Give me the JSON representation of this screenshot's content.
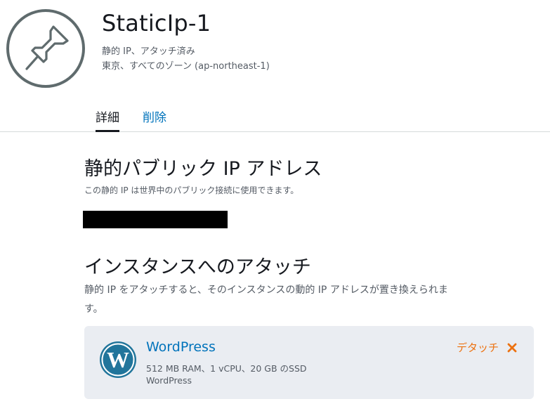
{
  "header": {
    "title": "StaticIp-1",
    "subtitle_status": "静的 IP、アタッチ済み",
    "subtitle_location": "東京、すべてのゾーン (ap-northeast-1)",
    "icon": "pin-icon"
  },
  "tabs": [
    {
      "label": "詳細",
      "active": true
    },
    {
      "label": "削除",
      "active": false
    }
  ],
  "public_ip_section": {
    "title": "静的パブリック IP アドレス",
    "description": "この静的 IP は世界中のパブリック接続に使用できます。"
  },
  "attach_section": {
    "title": "インスタンスへのアタッチ",
    "description_line1": "静的 IP をアタッチすると、そのインスタンスの動的 IP アドレスが置き換えられま",
    "description_line2": "す。"
  },
  "instance_card": {
    "name": "WordPress",
    "specs": "512 MB RAM、1 vCPU、20 GB のSSD",
    "blueprint": "WordPress",
    "detach_label": "デタッチ",
    "icon": "wordpress-logo-icon",
    "close_icon": "close-icon"
  },
  "colors": {
    "link": "#0073bb",
    "accent_orange": "#ec7211",
    "card_background": "#eaedf2",
    "text_primary": "#16191f",
    "text_secondary": "#545b64"
  }
}
